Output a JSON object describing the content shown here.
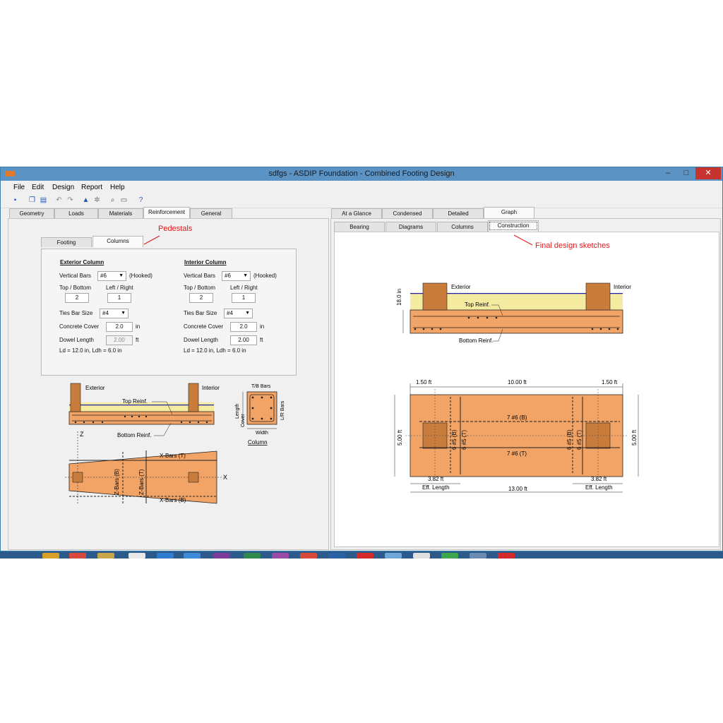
{
  "window": {
    "title": "sdfgs - ASDIP Foundation - Combined Footing Design",
    "min": "–",
    "max": "□",
    "close": "✕"
  },
  "menu": [
    "File",
    "Edit",
    "Design",
    "Report",
    "Help"
  ],
  "left_tabs": [
    "Geometry",
    "Loads",
    "Materials",
    "Reinforcement",
    "General"
  ],
  "sub_tabs": [
    "Footing",
    "Columns"
  ],
  "annotations": {
    "pedestals": "Pedestals",
    "final": "Final design sketches"
  },
  "exterior": {
    "title": "Exterior Column",
    "vbars_label": "Vertical Bars",
    "vbars": "#6",
    "hooked": "(Hooked)",
    "tb_label": "Top / Bottom",
    "lr_label": "Left / Right",
    "tb": "2",
    "lr": "1",
    "ties_label": "Ties Bar Size",
    "ties": "#4",
    "cover_label": "Concrete Cover",
    "cover": "2.0",
    "cover_unit": "in",
    "dowel_label": "Dowel Length",
    "dowel": "2.00",
    "dowel_unit": "ft",
    "ld": "Ld = 12.0 in,   Ldh = 6.0 in"
  },
  "interior": {
    "title": "Interior Column",
    "vbars_label": "Vertical Bars",
    "vbars": "#6",
    "hooked": "(Hooked)",
    "tb_label": "Top / Bottom",
    "lr_label": "Left / Right",
    "tb": "2",
    "lr": "1",
    "ties_label": "Ties Bar Size",
    "ties": "#4",
    "cover_label": "Concrete Cover",
    "cover": "2.0",
    "cover_unit": "in",
    "dowel_label": "Dowel Length",
    "dowel": "2.00",
    "dowel_unit": "ft",
    "ld": "Ld = 12.0 in,   Ldh = 6.0 in"
  },
  "left_sketch": {
    "exterior": "Exterior",
    "interior": "Interior",
    "top": "Top Reinf.",
    "bottom": "Bottom Reinf.",
    "tb_bars": "T/B Bars",
    "lr_bars": "L/R Bars",
    "length": "Length",
    "cover": "Cover",
    "width": "Width",
    "column": "Column",
    "z": "Z",
    "x": "X",
    "xbars_t": "X-Bars (T)",
    "xbars_b": "X-Bars (B)",
    "zbars_b": "Z-Bars (B)",
    "zbars_t": "Z-Bars (T)"
  },
  "right_tabs": [
    "At a Glance",
    "Condensed",
    "Detailed",
    "Graph"
  ],
  "right_sub_tabs": [
    "Bearing",
    "Diagrams",
    "Columns",
    "Construction"
  ],
  "section": {
    "exterior": "Exterior",
    "interior": "Interior",
    "top": "Top Reinf.",
    "bottom": "Bottom Reinf.",
    "depth": "18.0 in"
  },
  "plan": {
    "d1": "1.50 ft",
    "d2": "10.00 ft",
    "d3": "1.50 ft",
    "width": "5.00 ft",
    "bars_b": "7 #6 (B)",
    "bars_t": "7 #6 (T)",
    "v1": "6 #5 (B)",
    "v2": "6 #5 (T)",
    "v3": "6 #5 (B)",
    "v4": "6 #5 (T)",
    "eff1": "3.82 ft",
    "eff2": "3.82 ft",
    "eff_lbl": "Eff. Length",
    "length": "13.00 ft"
  },
  "colors": {
    "footing": "#f2a466",
    "column": "#c97d3c",
    "soil": "#f5eba0",
    "red": "#e01b1b",
    "titlebar": "#5b93c5"
  }
}
